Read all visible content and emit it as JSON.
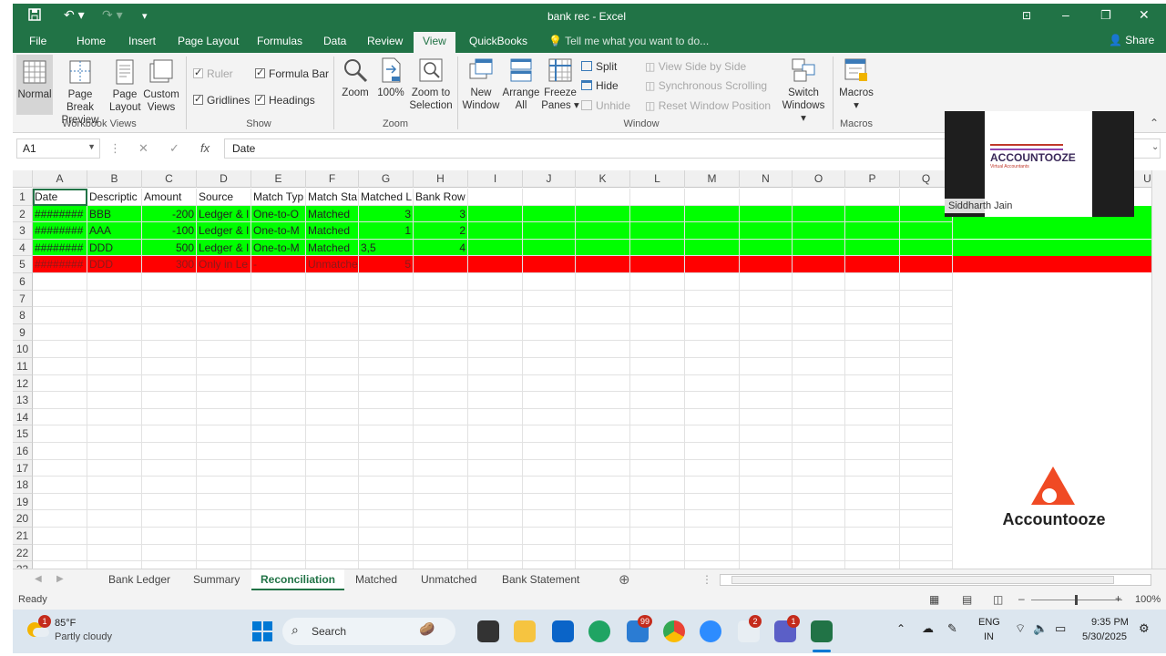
{
  "window": {
    "title": "bank rec - Excel"
  },
  "menu_tabs": [
    "File",
    "Home",
    "Insert",
    "Page Layout",
    "Formulas",
    "Data",
    "Review",
    "View",
    "QuickBooks"
  ],
  "active_tab": "View",
  "tell_me": "Tell me what you want to do...",
  "share": "Share",
  "ribbon": {
    "workbook_views": {
      "label": "Workbook Views",
      "normal": "Normal",
      "page_break_1": "Page Break",
      "page_break_2": "Preview",
      "page_layout_1": "Page",
      "page_layout_2": "Layout",
      "custom_1": "Custom",
      "custom_2": "Views"
    },
    "show": {
      "label": "Show",
      "ruler": "Ruler",
      "formula_bar": "Formula Bar",
      "gridlines": "Gridlines",
      "headings": "Headings"
    },
    "zoom": {
      "label": "Zoom",
      "zoom": "Zoom",
      "hundred": "100%",
      "zoom_sel_1": "Zoom to",
      "zoom_sel_2": "Selection"
    },
    "window": {
      "label": "Window",
      "new_1": "New",
      "new_2": "Window",
      "arrange_1": "Arrange",
      "arrange_2": "All",
      "freeze_1": "Freeze",
      "freeze_2": "Panes",
      "split": "Split",
      "hide": "Hide",
      "unhide": "Unhide",
      "side_by_side": "View Side by Side",
      "sync_scroll": "Synchronous Scrolling",
      "reset_pos": "Reset Window Position",
      "switch_1": "Switch",
      "switch_2": "Windows"
    },
    "macros": {
      "label": "Macros",
      "macros": "Macros"
    }
  },
  "formula_bar": {
    "name_box": "A1",
    "value": "Date"
  },
  "columns": [
    "A",
    "B",
    "C",
    "D",
    "E",
    "F",
    "G",
    "H",
    "I",
    "J",
    "K",
    "L",
    "M",
    "N",
    "O",
    "P",
    "Q",
    "U"
  ],
  "row_numbers": [
    "1",
    "2",
    "3",
    "4",
    "5",
    "6",
    "7",
    "8",
    "9",
    "10",
    "11",
    "12",
    "13",
    "14",
    "15",
    "16",
    "17",
    "18",
    "19",
    "20",
    "21",
    "22",
    "23"
  ],
  "rows": [
    [
      "Date",
      "Descriptic",
      "Amount",
      "Source",
      "Match Typ",
      "Match Sta",
      "Matched L",
      "Bank Row"
    ],
    [
      "########",
      "BBB",
      "-200",
      "Ledger & I",
      "One-to-O",
      "Matched",
      "3",
      "3"
    ],
    [
      "########",
      "AAA",
      "-100",
      "Ledger & I",
      "One-to-M",
      "Matched",
      "1",
      "2"
    ],
    [
      "########",
      "DDD",
      "500",
      "Ledger & I",
      "One-to-M",
      "Matched",
      "3,5",
      "4"
    ],
    [
      "########",
      "DDD",
      "300",
      "Only in Le",
      "-",
      "Unmatche",
      "5",
      ""
    ]
  ],
  "colors": {
    "excel_green": "#217346",
    "matched_fill": "#00ff00",
    "unmatched_fill": "#ff0000"
  },
  "sheet_tabs": [
    "Bank Ledger",
    "Summary",
    "Reconciliation",
    "Matched",
    "Unmatched",
    "Bank Statement"
  ],
  "active_sheet": "Reconciliation",
  "status": {
    "ready": "Ready",
    "zoom": "100%"
  },
  "webcam": {
    "name": "Siddharth Jain",
    "logo_text": "ACCOUNTOOZE",
    "logo_sub": "Virtual Accountants"
  },
  "brand": {
    "text": "Accountooze"
  },
  "taskbar": {
    "temp": "85°F",
    "weather": "Partly cloudy",
    "weather_badge": "1",
    "search": "Search",
    "lang_1": "ENG",
    "lang_2": "IN",
    "time": "9:35 PM",
    "date": "5/30/2025",
    "badge_99": "99",
    "badge_2": "2",
    "badge_1": "1"
  }
}
